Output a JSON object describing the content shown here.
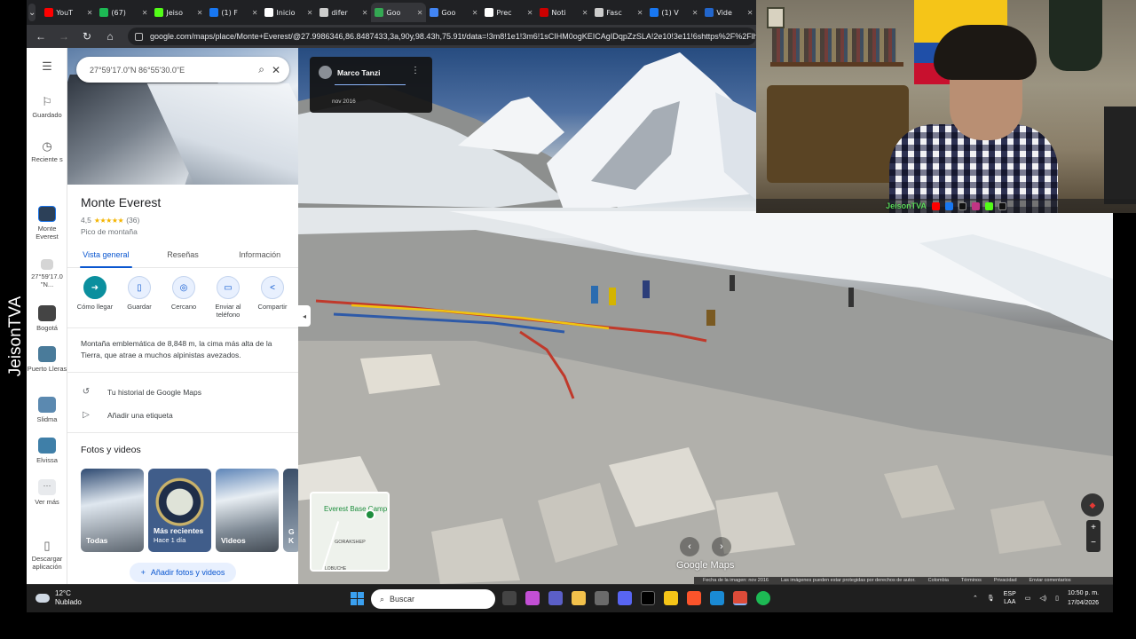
{
  "browser": {
    "tabs": [
      {
        "label": "YouT",
        "color": "#ff0000",
        "active": false
      },
      {
        "label": "(67)",
        "color": "#1db954",
        "active": false
      },
      {
        "label": "Jeiso",
        "color": "#53fc18",
        "active": false
      },
      {
        "label": "(1) F",
        "color": "#1877f2",
        "active": false
      },
      {
        "label": "Inicio",
        "color": "#ffffff",
        "active": false
      },
      {
        "label": "difer",
        "color": "#cccccc",
        "active": false
      },
      {
        "label": "Goo",
        "color": "#34a853",
        "active": true
      },
      {
        "label": "Goo",
        "color": "#4285f4",
        "active": false
      },
      {
        "label": "Prec",
        "color": "#ffffff",
        "active": false
      },
      {
        "label": "Noti",
        "color": "#cc0000",
        "active": false
      },
      {
        "label": "Fasc",
        "color": "#cccccc",
        "active": false
      },
      {
        "label": "(1) V",
        "color": "#1877f2",
        "active": false
      },
      {
        "label": "Vide",
        "color": "#2266cc",
        "active": false
      }
    ],
    "url": "google.com/maps/place/Monte+Everest/@27.9986346,86.8487433,3a,90y,98.43h,75.91t/data=!3m8!1e1!3m6!1sCIHM0ogKEICAgIDqpZzSLA!2e10!3e11!6shttps%2F%2Flh3.google"
  },
  "rail": {
    "items": [
      {
        "label": "Guardado",
        "icon": "bookmark-icon"
      },
      {
        "label": "Reciente s",
        "icon": "history-icon"
      },
      {
        "label": "Monte Everest",
        "icon": "place-thumb"
      },
      {
        "label": "27°59'17.0 \"N...",
        "icon": "coords-thumb"
      },
      {
        "label": "Bogotá",
        "icon": "place-thumb"
      },
      {
        "label": "Puerto Lleras",
        "icon": "place-thumb"
      },
      {
        "label": "Slidma",
        "icon": "place-thumb"
      },
      {
        "label": "Elvissa",
        "icon": "place-thumb"
      },
      {
        "label": "Ver más",
        "icon": "more-icon"
      },
      {
        "label": "Descargar aplicación",
        "icon": "phone-icon"
      }
    ]
  },
  "panel": {
    "search_value": "27°59'17.0\"N 86°55'30.0\"E",
    "title": "Monte Everest",
    "rating": "4,5",
    "stars": "★★★★★",
    "reviews": "(36)",
    "category": "Pico de montaña",
    "tabs": [
      "Vista general",
      "Reseñas",
      "Información"
    ],
    "actions": [
      {
        "label": "Cómo llegar",
        "icon": "directions-icon",
        "glyph": "➜"
      },
      {
        "label": "Guardar",
        "icon": "bookmark-icon",
        "glyph": "▯"
      },
      {
        "label": "Cercano",
        "icon": "nearby-icon",
        "glyph": "◎"
      },
      {
        "label": "Enviar al teléfono",
        "icon": "send-phone-icon",
        "glyph": "▭"
      },
      {
        "label": "Compartir",
        "icon": "share-icon",
        "glyph": "<"
      }
    ],
    "description": "Montaña emblemática de 8,848 m, la cima más alta de la Tierra, que atrae a muchos alpinistas avezados.",
    "history_link": "Tu historial de Google Maps",
    "label_link": "Añadir una etiqueta",
    "photos_title": "Fotos y videos",
    "photos": [
      {
        "label": "Todas",
        "sub": ""
      },
      {
        "label": "Más recientes",
        "sub": "Hace 1 día"
      },
      {
        "label": "Videos",
        "sub": ""
      },
      {
        "label": "G K",
        "sub": ""
      }
    ],
    "add_photos": "Añadir fotos y videos"
  },
  "streetview": {
    "author": "Marco Tanzi",
    "date": "nov 2016",
    "minimap": {
      "label": "Everest Base Camp",
      "town": "GORAKSHEP",
      "town2": "LOBUCHE"
    },
    "watermark": "Google Maps",
    "footer": [
      "Fecha de la imagen: nov 2016",
      "Las imágenes pueden estar protegidas por derechos de autor.",
      "Colombia",
      "Términos",
      "Privacidad",
      "Enviar comentarios"
    ]
  },
  "overlay": {
    "channel_vertical": "JeisonTVA",
    "cam_tag": "JeisonTVA"
  },
  "taskbar": {
    "temp": "12°C",
    "weather": "Nublado",
    "search_placeholder": "Buscar",
    "lang": "ESP",
    "lang2": "LAA",
    "time": "10:50 p. m.",
    "date": "17/04/2026"
  }
}
